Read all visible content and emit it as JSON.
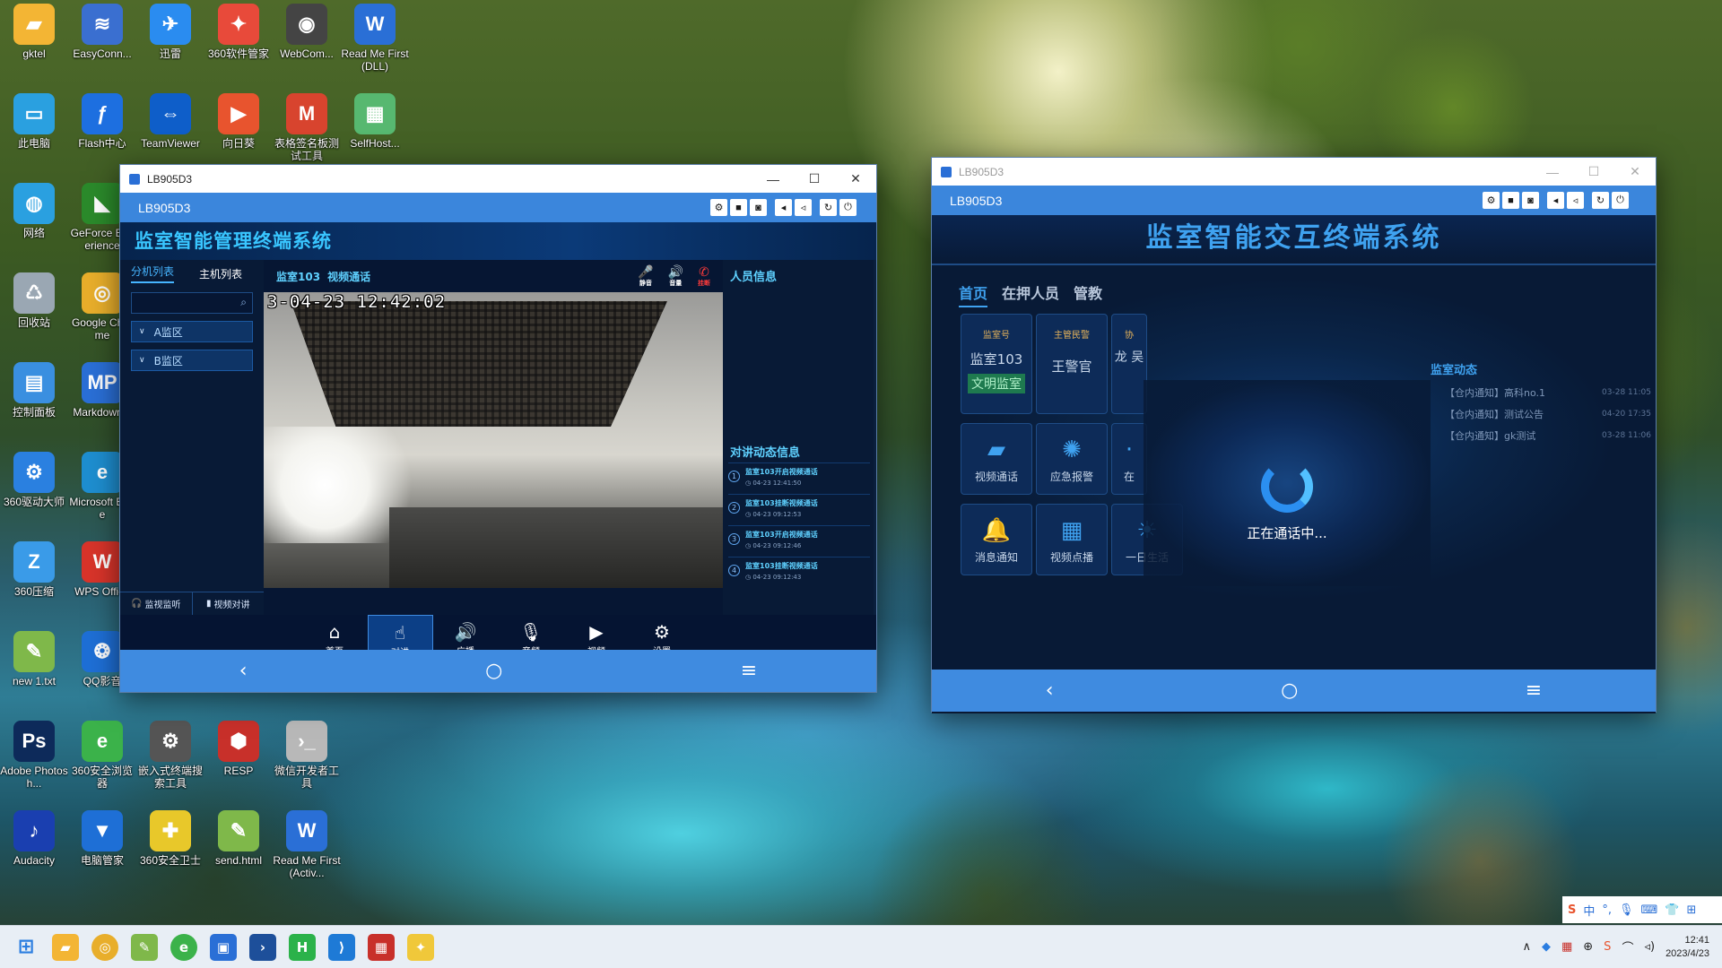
{
  "desktop_icons": [
    {
      "label": "gktel",
      "color": "#f3b534",
      "glyph": "▰"
    },
    {
      "label": "EasyConn...",
      "color": "#3a6fd0",
      "glyph": "≋"
    },
    {
      "label": "迅雷",
      "color": "#2a8cf0",
      "glyph": "✈"
    },
    {
      "label": "360软件管家",
      "color": "#e84a3a",
      "glyph": "✦"
    },
    {
      "label": "WebCom...",
      "color": "#444444",
      "glyph": "◉"
    },
    {
      "label": "Read Me First(DLL)",
      "color": "#2a6fd6",
      "glyph": "W"
    },
    {
      "label": "此电脑",
      "color": "#2aa0e0",
      "glyph": "▭"
    },
    {
      "label": "Flash中心",
      "color": "#1d6fe0",
      "glyph": "ƒ"
    },
    {
      "label": "TeamViewer",
      "color": "#0e5ec9",
      "glyph": "⇔"
    },
    {
      "label": "向日葵",
      "color": "#e8542e",
      "glyph": "▶"
    },
    {
      "label": "表格签名板测试工具",
      "color": "#d8442e",
      "glyph": "M"
    },
    {
      "label": "SelfHost...",
      "color": "#57b870",
      "glyph": "▦"
    },
    {
      "label": "网络",
      "color": "#2aa0e0",
      "glyph": "◍"
    },
    {
      "label": "GeForce Experience",
      "color": "#2b8a2b",
      "glyph": "◣"
    },
    {
      "label": "回收站",
      "color": "#9aa7b3",
      "glyph": "♺"
    },
    {
      "label": "Google Chrome",
      "color": "#e8ae2b",
      "glyph": "◎"
    },
    {
      "label": "控制面板",
      "color": "#3a8fe0",
      "glyph": "▤"
    },
    {
      "label": "Markdown 2",
      "color": "#2a6fd6",
      "glyph": "MP"
    },
    {
      "label": "360驱动大师",
      "color": "#2a80e0",
      "glyph": "⚙"
    },
    {
      "label": "Microsoft Edge",
      "color": "#1e8ed0",
      "glyph": "e"
    },
    {
      "label": "360压缩",
      "color": "#3a9be8",
      "glyph": "Z"
    },
    {
      "label": "WPS Office",
      "color": "#d8342a",
      "glyph": "W"
    },
    {
      "label": "new 1.txt",
      "color": "#7fb84a",
      "glyph": "✎"
    },
    {
      "label": "QQ影音",
      "color": "#1e6fd6",
      "glyph": "❂"
    },
    {
      "label": "Adobe Photosh...",
      "color": "#0d2a5a",
      "glyph": "Ps"
    },
    {
      "label": "360安全浏览器",
      "color": "#3bb24a",
      "glyph": "e"
    },
    {
      "label": "嵌入式终端搜索工具",
      "color": "#555555",
      "glyph": "⚙"
    },
    {
      "label": "RESP",
      "color": "#c8302a",
      "glyph": "⬢"
    },
    {
      "label": "微信开发者工具",
      "color": "#b8b8b8",
      "glyph": "›_"
    },
    {
      "label": "Audacity",
      "color": "#1a3fb0",
      "glyph": "♪"
    },
    {
      "label": "电脑管家",
      "color": "#1e6fd6",
      "glyph": "▼"
    },
    {
      "label": "360安全卫士",
      "color": "#e8c82a",
      "glyph": "✚"
    },
    {
      "label": "send.html",
      "color": "#7fb84a",
      "glyph": "✎"
    },
    {
      "label": "Read Me First(Activ...",
      "color": "#2a6fd6",
      "glyph": "W"
    }
  ],
  "left_window": {
    "os_title": "LB905D3",
    "app_title": "LB905D3",
    "system_name": "监室智能管理终端系统",
    "sidebar": {
      "tabs": [
        "分机列表",
        "主机列表"
      ],
      "search_placeholder": "",
      "groups": [
        "A监区",
        "B监区"
      ],
      "footer": [
        "监视监听",
        "视频对讲"
      ]
    },
    "video": {
      "room": "监室103",
      "mode": "视频通话",
      "controls": [
        {
          "icon": "microphone-icon",
          "label": "静音"
        },
        {
          "icon": "speaker-icon",
          "label": "音量"
        },
        {
          "icon": "hangup-icon",
          "label": "挂断"
        }
      ],
      "osd": "3-04-23  12:42:02"
    },
    "info": {
      "title": "人员信息",
      "talk_title": "对讲动态信息",
      "talk_items": [
        {
          "n": "1",
          "text": "监室103开启视频通话",
          "time": "04-23 12:41:50"
        },
        {
          "n": "2",
          "text": "监室103挂断视频通话",
          "time": "04-23 09:12:53"
        },
        {
          "n": "3",
          "text": "监室103开启视频通话",
          "time": "04-23 09:12:46"
        },
        {
          "n": "4",
          "text": "监室103挂断视频通话",
          "time": "04-23 09:12:43"
        }
      ]
    },
    "bottom_tools": [
      {
        "label": "首页",
        "glyph": "⌂"
      },
      {
        "label": "对讲",
        "glyph": "☝"
      },
      {
        "label": "广播",
        "glyph": "🔊"
      },
      {
        "label": "音频",
        "glyph": "🎙"
      },
      {
        "label": "视频",
        "glyph": "▶"
      },
      {
        "label": "设置",
        "glyph": "⚙"
      }
    ]
  },
  "right_window": {
    "os_title": "LB905D3",
    "app_title": "LB905D3",
    "system_name": "监室智能交互终端系统",
    "tabs": [
      "首页",
      "在押人员",
      "管教"
    ],
    "cards": [
      {
        "head": "监室号",
        "value": "监室103",
        "tag": "文明监室"
      },
      {
        "head": "主管民警",
        "value": "王警官",
        "tag": ""
      },
      {
        "head": "协",
        "value": "龙 吴",
        "tag": ""
      }
    ],
    "tiles": [
      "视频通话",
      "应急报警",
      "在",
      "消息通知",
      "视频点播",
      "一日生活"
    ],
    "news_title": "监室动态",
    "news": [
      {
        "text": "【仓内通知】高科no.1",
        "date": "03-28 11:05"
      },
      {
        "text": "【仓内通知】测试公告",
        "date": "04-20 17:35"
      },
      {
        "text": "【仓内通知】gk测试",
        "date": "03-28 11:06"
      }
    ],
    "calling_text": "正在通话中..."
  },
  "taskbar": {
    "time": "12:41",
    "date": "2023/4/23",
    "ime_lang": "中"
  }
}
